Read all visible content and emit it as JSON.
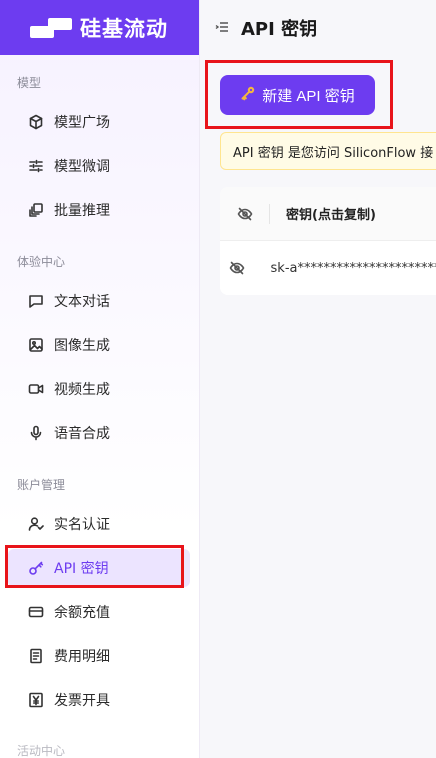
{
  "brand": {
    "name": "硅基流动"
  },
  "sidebar": {
    "sections": [
      {
        "title": "模型"
      },
      {
        "title": "体验中心"
      },
      {
        "title": "账户管理"
      },
      {
        "title": "活动中心"
      }
    ],
    "items": [
      {
        "label": "模型广场",
        "icon": "cube-icon"
      },
      {
        "label": "模型微调",
        "icon": "sliders-icon"
      },
      {
        "label": "批量推理",
        "icon": "layers-icon"
      },
      {
        "label": "文本对话",
        "icon": "chat-icon"
      },
      {
        "label": "图像生成",
        "icon": "image-icon"
      },
      {
        "label": "视频生成",
        "icon": "video-icon"
      },
      {
        "label": "语音合成",
        "icon": "mic-icon"
      },
      {
        "label": "实名认证",
        "icon": "user-check-icon"
      },
      {
        "label": "API 密钥",
        "icon": "key-icon",
        "active": true
      },
      {
        "label": "余额充值",
        "icon": "card-icon"
      },
      {
        "label": "费用明细",
        "icon": "doc-icon"
      },
      {
        "label": "发票开具",
        "icon": "yen-icon"
      }
    ]
  },
  "header": {
    "title": "API 密钥"
  },
  "main": {
    "new_key_button": "新建 API 密钥",
    "notice": "API 密钥 是您访问 SiliconFlow 接",
    "table": {
      "header_key": "密钥(点击复制)",
      "rows": [
        {
          "key": "sk-a*************************"
        }
      ]
    }
  },
  "colors": {
    "brand": "#6d3cf0",
    "highlight": "#e8141a",
    "notice_bg": "#fffbe6"
  }
}
